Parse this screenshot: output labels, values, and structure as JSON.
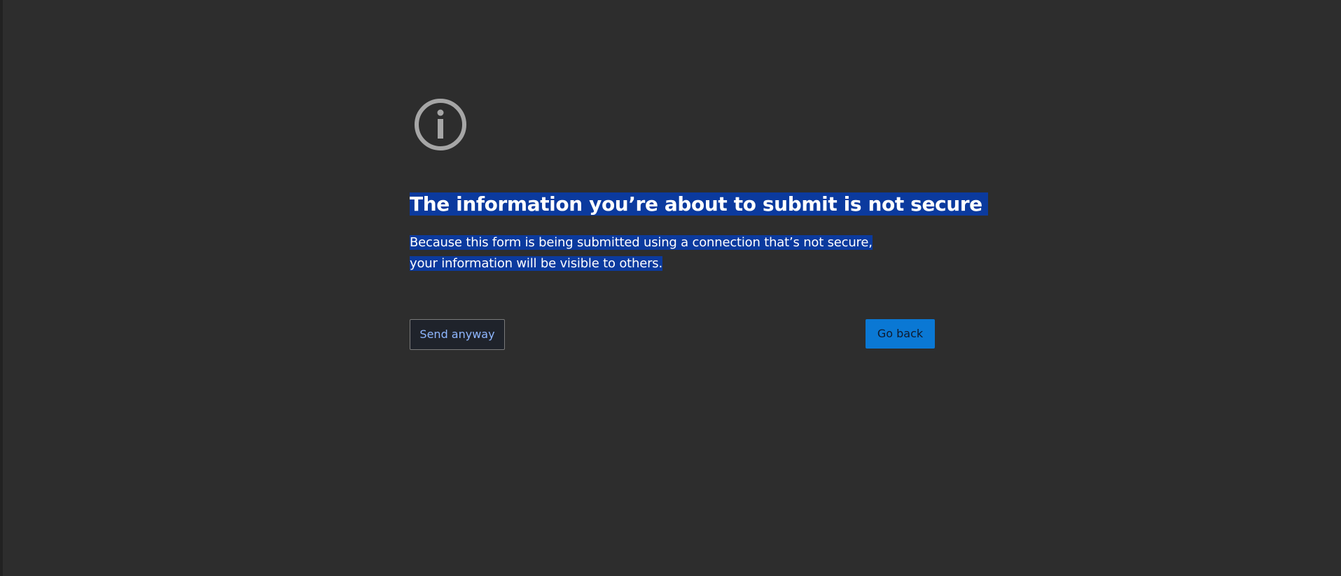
{
  "warning": {
    "icon": "info-icon",
    "title": "The information you’re about to submit is not secure",
    "description": "Because this form is being submitted using a connection that’s not secure, your information will be visible to others."
  },
  "actions": {
    "send_anyway_label": "Send anyway",
    "go_back_label": "Go back"
  },
  "colors": {
    "background": "#2d2d2d",
    "selection": "#0b3a9e",
    "primary_button": "#0a78d4",
    "secondary_button_text": "#8fb7ff",
    "icon": "#a6a6a6"
  }
}
